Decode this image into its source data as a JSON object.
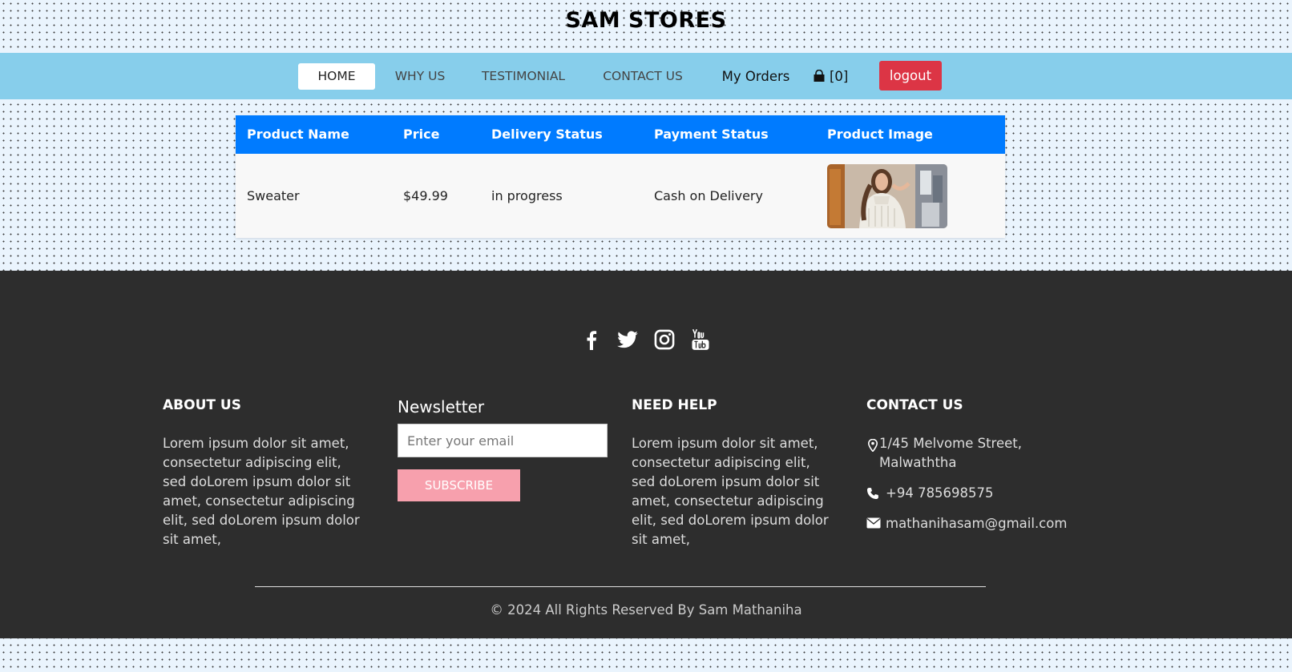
{
  "site": {
    "title": "SAM STORES"
  },
  "nav": {
    "items": [
      {
        "label": "HOME",
        "active": true
      },
      {
        "label": "WHY US"
      },
      {
        "label": "TESTIMONIAL"
      },
      {
        "label": "CONTACT US"
      }
    ],
    "orders_label": "My Orders",
    "cart_label": "[0]",
    "cart_icon": "shopping-bag-icon",
    "logout_label": "logout"
  },
  "orders": {
    "headers": [
      "Product Name",
      "Price",
      "Delivery Status",
      "Payment Status",
      "Product Image"
    ],
    "rows": [
      {
        "name": "Sweater",
        "price": "$49.99",
        "delivery": "in progress",
        "payment": "Cash on Delivery",
        "image": "sweater-photo"
      }
    ]
  },
  "footer": {
    "social_icons": [
      "facebook-icon",
      "twitter-icon",
      "instagram-icon",
      "youtube-icon"
    ],
    "about": {
      "title": "ABOUT US",
      "text": "Lorem ipsum dolor sit amet, consectetur adipiscing elit, sed doLorem ipsum dolor sit amet, consectetur adipiscing elit, sed doLorem ipsum dolor sit amet,"
    },
    "newsletter": {
      "title": "Newsletter",
      "placeholder": "Enter your email",
      "button": "SUBSCRIBE"
    },
    "help": {
      "title": "NEED HELP",
      "text": "Lorem ipsum dolor sit amet, consectetur adipiscing elit, sed doLorem ipsum dolor sit amet, consectetur adipiscing elit, sed doLorem ipsum dolor sit amet,"
    },
    "contact": {
      "title": "CONTACT US",
      "address_line1": "1/45 Melvome Street,",
      "address_line2": "Malwaththa",
      "phone": "+94 785698575",
      "email": "mathanihasam@gmail.com"
    },
    "copyright": "© 2024 All Rights Reserved By Sam Mathaniha"
  },
  "colors": {
    "navbar": "#87ceeb",
    "table_header": "#007bff",
    "logout": "#dc3545",
    "footer": "#2d2d2d",
    "subscribe": "#f7a0ad"
  }
}
